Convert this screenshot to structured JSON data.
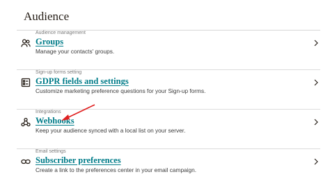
{
  "page": {
    "title": "Audience"
  },
  "items": [
    {
      "category": "Audience management",
      "title": "Groups",
      "description": "Manage your contacts' groups.",
      "icon": "groups-icon"
    },
    {
      "category": "Sign-up forms setting",
      "title": "GDPR fields and settings",
      "description": "Customize marketing preference questions for your Sign-up forms.",
      "icon": "gdpr-form-icon"
    },
    {
      "category": "Integrations",
      "title": "Webhooks",
      "description": "Keep your audience synced with a local list on your server.",
      "icon": "webhooks-icon"
    },
    {
      "category": "Email settings",
      "title": "Subscriber preferences",
      "description": "Create a link to the preferences center in your email campaign.",
      "icon": "link-icon"
    }
  ],
  "colors": {
    "link": "#007c89",
    "text": "#241c15",
    "annotation": "#e02020"
  }
}
